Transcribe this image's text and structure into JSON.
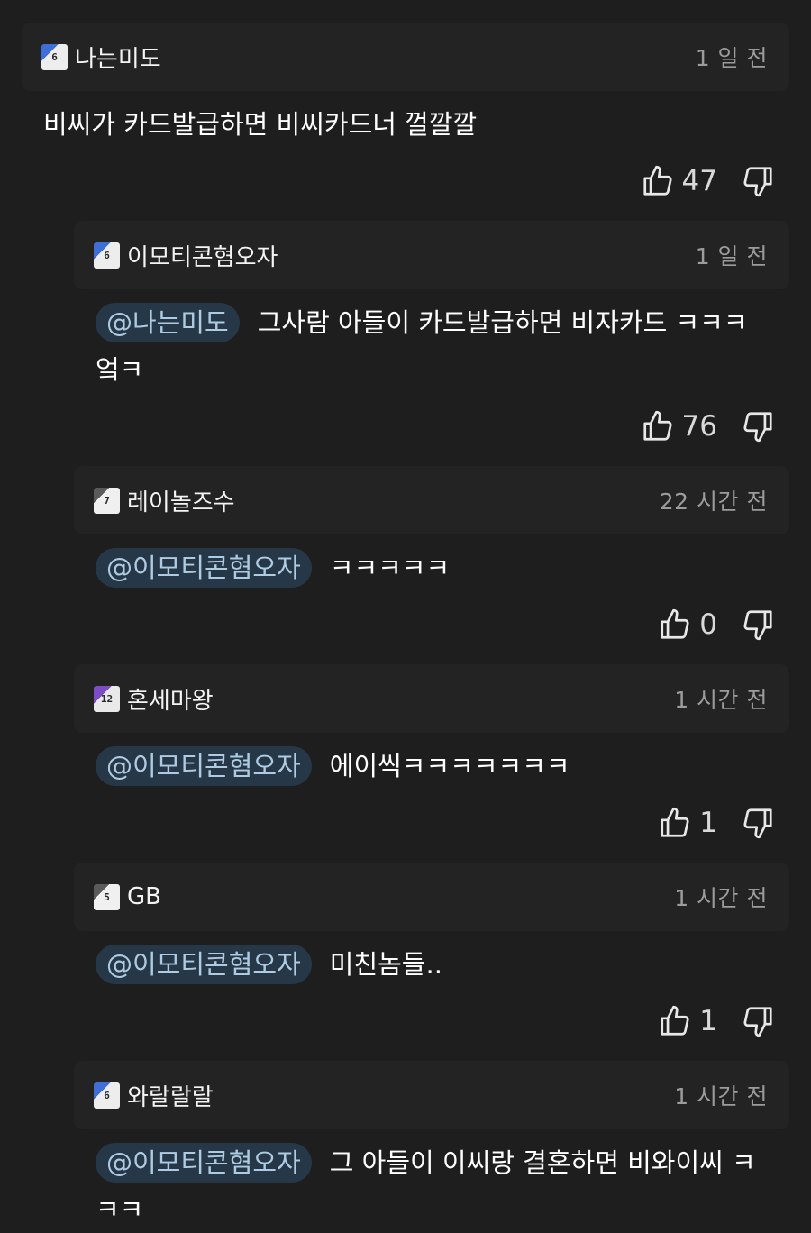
{
  "comments": [
    {
      "author": "나는미도",
      "level": "6",
      "time": "1 일 전",
      "mention": "",
      "text": "비씨가 카드발급하면 비씨카드너 껄깔깔",
      "text2": "",
      "likes": "47"
    },
    {
      "author": "이모티콘혐오자",
      "level": "6",
      "time": "1 일 전",
      "mention": "@나는미도",
      "text": "그사람 아들이 카드발급하면 비자카드 ㅋㅋㅋ",
      "text2": "엌ㅋ",
      "likes": "76"
    },
    {
      "author": "레이놀즈수",
      "level": "7",
      "time": "22 시간 전",
      "mention": "@이모티콘혐오자",
      "text": "ㅋㅋㅋㅋㅋ",
      "text2": "",
      "likes": "0"
    },
    {
      "author": "혼세마왕",
      "level": "12",
      "time": "1 시간 전",
      "mention": "@이모티콘혐오자",
      "text": "에이씩ㅋㅋㅋㅋㅋㅋㅋ",
      "text2": "",
      "likes": "1"
    },
    {
      "author": "GB",
      "level": "5",
      "time": "1 시간 전",
      "mention": "@이모티콘혐오자",
      "text": "미친놈들..",
      "text2": "",
      "likes": "1"
    },
    {
      "author": "와랄랄랄",
      "level": "6",
      "time": "1 시간 전",
      "mention": "@이모티콘혐오자",
      "text": "그 아들이 이씨랑 결혼하면 비와이씨 ㅋ",
      "text2": "ㅋㅋ",
      "likes": ""
    }
  ],
  "icons": {
    "like": "thumbs-up-icon",
    "dislike": "thumbs-down-icon"
  },
  "colors": {
    "background": "#1e1e1e",
    "header": "#232323",
    "mention_bg": "#263848",
    "mention_text": "#aecbe2",
    "muted": "#9c9c9c"
  }
}
